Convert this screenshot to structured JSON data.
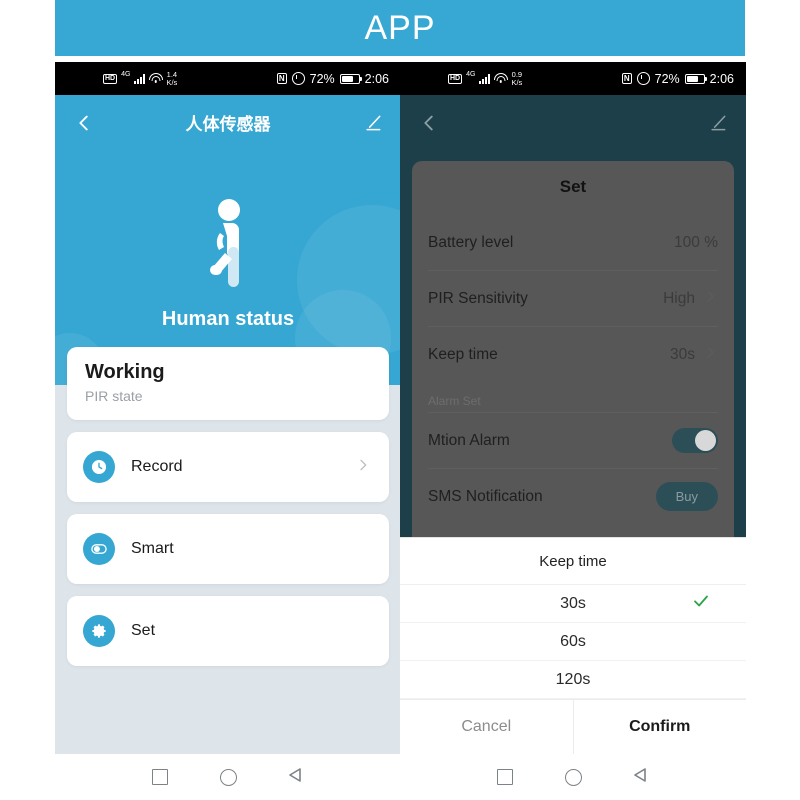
{
  "banner": {
    "title": "APP"
  },
  "left_phone": {
    "status_bar": {
      "hd": "HD",
      "network": "4G",
      "data_rate_value": "1.4",
      "data_rate_unit": "K/s",
      "nfc": "N",
      "battery_percent": "72%",
      "time": "2:06"
    },
    "header": {
      "title": "人体传感器",
      "back_icon": "chevron-left-icon",
      "edit_icon": "pencil-icon"
    },
    "hero": {
      "icon": "walking-person-icon",
      "label": "Human status"
    },
    "status_card": {
      "title": "Working",
      "subtitle": "PIR state"
    },
    "menu": [
      {
        "label": "Record",
        "icon": "clock-icon",
        "has_chevron": true
      },
      {
        "label": "Smart",
        "icon": "toggle-switch-icon",
        "has_chevron": false
      },
      {
        "label": "Set",
        "icon": "gear-icon",
        "has_chevron": false
      }
    ],
    "nav_bar": {
      "recents": "square-icon",
      "home": "circle-icon",
      "back": "triangle-left-icon"
    }
  },
  "right_phone": {
    "status_bar": {
      "hd": "HD",
      "network": "4G",
      "data_rate_value": "0.9",
      "data_rate_unit": "K/s",
      "nfc": "N",
      "battery_percent": "72%",
      "time": "2:06"
    },
    "header": {
      "back_icon": "chevron-left-icon",
      "edit_icon": "pencil-icon"
    },
    "settings_panel": {
      "title": "Set",
      "rows": [
        {
          "key": "Battery level",
          "value": "100 %",
          "chevron": false
        },
        {
          "key": "PIR Sensitivity",
          "value": "High",
          "chevron": true
        },
        {
          "key": "Keep time",
          "value": "30s",
          "chevron": true
        }
      ],
      "section_label": "Alarm Set",
      "motion_alarm": {
        "label": "Mtion Alarm",
        "enabled": true
      },
      "sms_notification": {
        "label": "SMS Notification",
        "action_label": "Buy"
      }
    },
    "sheet": {
      "title": "Keep time",
      "options": [
        {
          "label": "30s",
          "selected": true
        },
        {
          "label": "60s",
          "selected": false
        },
        {
          "label": "120s",
          "selected": false
        }
      ],
      "cancel_label": "Cancel",
      "confirm_label": "Confirm"
    },
    "nav_bar": {
      "recents": "square-icon",
      "home": "circle-icon",
      "back": "triangle-left-icon"
    }
  },
  "colors": {
    "brand_blue": "#36a7d2",
    "page_bg": "#dde5ea",
    "check_green": "#2aa34a",
    "dim_overlay": "#1d3f49"
  }
}
